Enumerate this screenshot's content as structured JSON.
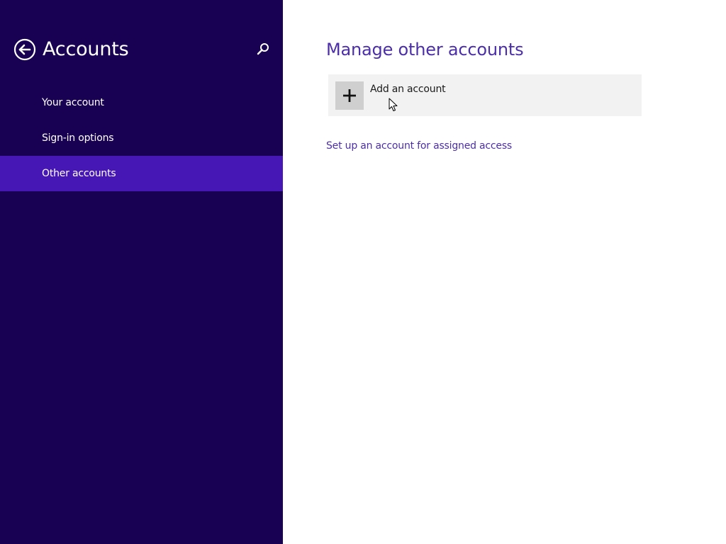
{
  "nav": {
    "title": "Accounts",
    "back_icon": "back-arrow-icon",
    "search_icon": "search-icon",
    "items": [
      {
        "label": "Your account",
        "selected": false
      },
      {
        "label": "Sign-in options",
        "selected": false
      },
      {
        "label": "Other accounts",
        "selected": true
      }
    ]
  },
  "main": {
    "title": "Manage other accounts",
    "add_account": {
      "label": "Add an account",
      "icon": "plus-icon"
    },
    "assigned_access_link": "Set up an account for assigned access"
  },
  "colors": {
    "nav_background": "#180052",
    "nav_selected": "#4617b4",
    "accent_text": "#4b2fa8",
    "tile_background": "#f2f2f2",
    "tile_icon_background": "#cfcfcf"
  }
}
